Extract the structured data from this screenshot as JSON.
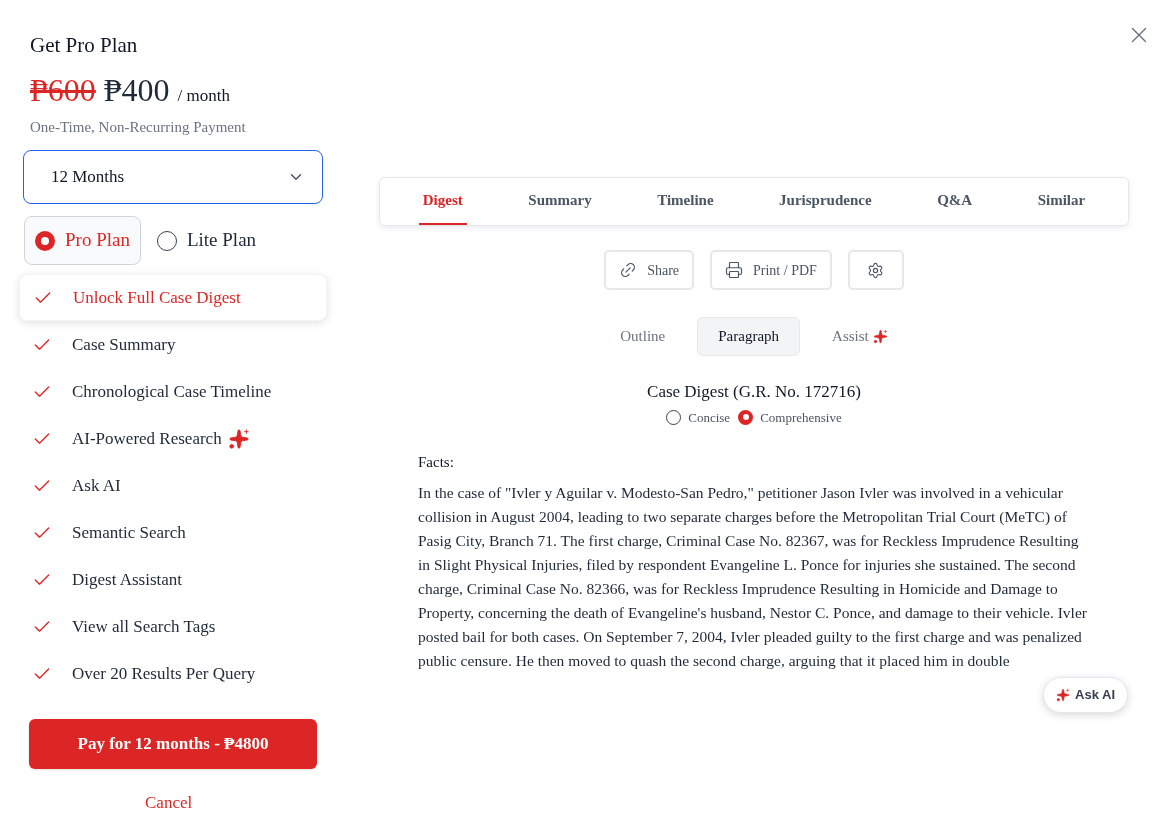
{
  "plan": {
    "title": "Get Pro Plan",
    "old_price": "₱600",
    "price": "₱400",
    "period": "/ month",
    "note": "One-Time, Non-Recurring Payment"
  },
  "duration_select": {
    "value": "12 Months"
  },
  "plan_options": [
    {
      "label": "Pro Plan",
      "selected": true
    },
    {
      "label": "Lite Plan",
      "selected": false
    }
  ],
  "features": [
    {
      "label": "Unlock Full Case Digest",
      "selected": true,
      "sparkle": false
    },
    {
      "label": "Case Summary",
      "selected": false,
      "sparkle": false
    },
    {
      "label": "Chronological Case Timeline",
      "selected": false,
      "sparkle": false
    },
    {
      "label": "AI-Powered Research",
      "selected": false,
      "sparkle": true
    },
    {
      "label": "Ask AI",
      "selected": false,
      "sparkle": false
    },
    {
      "label": "Semantic Search",
      "selected": false,
      "sparkle": false
    },
    {
      "label": "Digest Assistant",
      "selected": false,
      "sparkle": false
    },
    {
      "label": "View all Search Tags",
      "selected": false,
      "sparkle": false
    },
    {
      "label": "Over 20 Results Per Query",
      "selected": false,
      "sparkle": false
    }
  ],
  "pay_button": "Pay for 12 months - ₱4800",
  "cancel_link": "Cancel",
  "tabs": [
    {
      "label": "Digest",
      "selected": true
    },
    {
      "label": "Summary",
      "selected": false
    },
    {
      "label": "Timeline",
      "selected": false
    },
    {
      "label": "Jurisprudence",
      "selected": false
    },
    {
      "label": "Q&A",
      "selected": false
    },
    {
      "label": "Similar",
      "selected": false
    }
  ],
  "actions": [
    {
      "kind": "share",
      "label": "Share"
    },
    {
      "kind": "print",
      "label": "Print / PDF"
    },
    {
      "kind": "settings"
    }
  ],
  "view_modes": [
    {
      "label": "Outline",
      "selected": false,
      "sparkle": false
    },
    {
      "label": "Paragraph",
      "selected": true,
      "sparkle": false
    },
    {
      "label": "Assist",
      "selected": false,
      "sparkle": true
    }
  ],
  "digest": {
    "title": "Case Digest (G.R. No. 172716)",
    "detail_options": [
      {
        "label": "Concise",
        "selected": false
      },
      {
        "label": "Comprehensive",
        "selected": true
      }
    ],
    "section": "Facts:",
    "text": "In the case of \"Ivler y Aguilar v. Modesto-San Pedro,\" petitioner Jason Ivler was involved in a vehicular collision in August 2004, leading to two separate charges before the Metropolitan Trial Court (MeTC) of Pasig City, Branch 71. The first charge, Criminal Case No. 82367, was for Reckless Imprudence Resulting in Slight Physical Injuries, filed by respondent Evangeline L. Ponce for injuries she sustained. The second charge, Criminal Case No. 82366, was for Reckless Imprudence Resulting in Homicide and Damage to Property, concerning the death of Evangeline's husband, Nestor C. Ponce, and damage to their vehicle. Ivler posted bail for both cases. On September 7, 2004, Ivler pleaded guilty to the first charge and was penalized public censure. He then moved to quash the second charge, arguing that it placed him in double"
  },
  "ask_ai_button": "Ask AI"
}
